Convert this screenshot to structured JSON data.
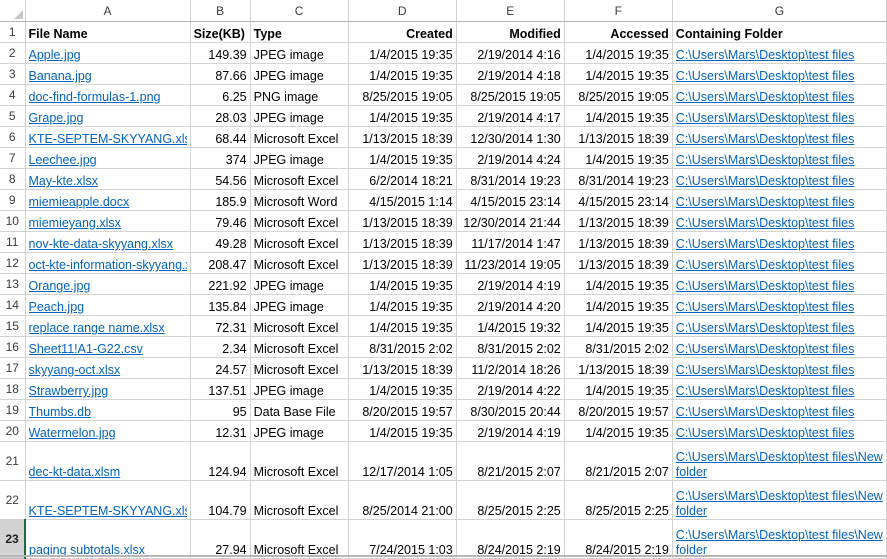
{
  "app": {
    "type": "spreadsheet",
    "corner_select_all": "select-all-corner"
  },
  "colors": {
    "hyperlink": "#0563C1",
    "gridline": "#D4D4D4",
    "header_text": "#3B3B3B",
    "active_row_fill": "#D3D3D3",
    "active_row_accent": "#1E6B41"
  },
  "column_headers": [
    "A",
    "B",
    "C",
    "D",
    "E",
    "F",
    "G"
  ],
  "row_headers": [
    "1",
    "2",
    "3",
    "4",
    "5",
    "6",
    "7",
    "8",
    "9",
    "10",
    "11",
    "12",
    "13",
    "14",
    "15",
    "16",
    "17",
    "18",
    "19",
    "20",
    "21",
    "22",
    "23"
  ],
  "active_row": "23",
  "table": {
    "headers": [
      "File Name",
      "Size(KB)",
      "Type",
      "Created",
      "Modified",
      "Accessed",
      "Containing Folder"
    ],
    "rows": [
      {
        "file_name": "Apple.jpg",
        "size": "149.39",
        "type": "JPEG image",
        "created": "1/4/2015 19:35",
        "modified": "2/19/2014 4:16",
        "accessed": "1/4/2015 19:35",
        "folder": "C:\\Users\\Mars\\Desktop\\test files"
      },
      {
        "file_name": "Banana.jpg",
        "size": "87.66",
        "type": "JPEG image",
        "created": "1/4/2015 19:35",
        "modified": "2/19/2014 4:18",
        "accessed": "1/4/2015 19:35",
        "folder": "C:\\Users\\Mars\\Desktop\\test files"
      },
      {
        "file_name": "doc-find-formulas-1.png",
        "size": "6.25",
        "type": "PNG image",
        "created": "8/25/2015 19:05",
        "modified": "8/25/2015 19:05",
        "accessed": "8/25/2015 19:05",
        "folder": "C:\\Users\\Mars\\Desktop\\test files"
      },
      {
        "file_name": "Grape.jpg",
        "size": "28.03",
        "type": "JPEG image",
        "created": "1/4/2015 19:35",
        "modified": "2/19/2014 4:17",
        "accessed": "1/4/2015 19:35",
        "folder": "C:\\Users\\Mars\\Desktop\\test files"
      },
      {
        "file_name": "KTE-SEPTEM-SKYYANG.xlsx",
        "size": "68.44",
        "type": "Microsoft Excel",
        "created": "1/13/2015 18:39",
        "modified": "12/30/2014 1:30",
        "accessed": "1/13/2015 18:39",
        "folder": "C:\\Users\\Mars\\Desktop\\test files"
      },
      {
        "file_name": "Leechee.jpg",
        "size": "374",
        "type": "JPEG image",
        "created": "1/4/2015 19:35",
        "modified": "2/19/2014 4:24",
        "accessed": "1/4/2015 19:35",
        "folder": "C:\\Users\\Mars\\Desktop\\test files"
      },
      {
        "file_name": "May-kte.xlsx",
        "size": "54.56",
        "type": "Microsoft Excel",
        "created": "6/2/2014 18:21",
        "modified": "8/31/2014 19:23",
        "accessed": "8/31/2014 19:23",
        "folder": "C:\\Users\\Mars\\Desktop\\test files"
      },
      {
        "file_name": "miemieapple.docx",
        "size": "185.9",
        "type": "Microsoft Word",
        "created": "4/15/2015 1:14",
        "modified": "4/15/2015 23:14",
        "accessed": "4/15/2015 23:14",
        "folder": "C:\\Users\\Mars\\Desktop\\test files"
      },
      {
        "file_name": "miemieyang.xlsx",
        "size": "79.46",
        "type": "Microsoft Excel",
        "created": "1/13/2015 18:39",
        "modified": "12/30/2014 21:44",
        "accessed": "1/13/2015 18:39",
        "folder": "C:\\Users\\Mars\\Desktop\\test files"
      },
      {
        "file_name": "nov-kte-data-skyyang.xlsx",
        "size": "49.28",
        "type": "Microsoft Excel",
        "created": "1/13/2015 18:39",
        "modified": "11/17/2014 1:47",
        "accessed": "1/13/2015 18:39",
        "folder": "C:\\Users\\Mars\\Desktop\\test files"
      },
      {
        "file_name": "oct-kte-information-skyyang.xlsx",
        "size": "208.47",
        "type": "Microsoft Excel",
        "created": "1/13/2015 18:39",
        "modified": "11/23/2014 19:05",
        "accessed": "1/13/2015 18:39",
        "folder": "C:\\Users\\Mars\\Desktop\\test files"
      },
      {
        "file_name": "Orange.jpg",
        "size": "221.92",
        "type": "JPEG image",
        "created": "1/4/2015 19:35",
        "modified": "2/19/2014 4:19",
        "accessed": "1/4/2015 19:35",
        "folder": "C:\\Users\\Mars\\Desktop\\test files"
      },
      {
        "file_name": "Peach.jpg",
        "size": "135.84",
        "type": "JPEG image",
        "created": "1/4/2015 19:35",
        "modified": "2/19/2014 4:20",
        "accessed": "1/4/2015 19:35",
        "folder": "C:\\Users\\Mars\\Desktop\\test files"
      },
      {
        "file_name": "replace range name.xlsx",
        "size": "72.31",
        "type": "Microsoft Excel",
        "created": "1/4/2015 19:35",
        "modified": "1/4/2015 19:32",
        "accessed": "1/4/2015 19:35",
        "folder": "C:\\Users\\Mars\\Desktop\\test files"
      },
      {
        "file_name": "Sheet11!A1-G22.csv",
        "size": "2.34",
        "type": "Microsoft Excel",
        "created": "8/31/2015 2:02",
        "modified": "8/31/2015 2:02",
        "accessed": "8/31/2015 2:02",
        "folder": "C:\\Users\\Mars\\Desktop\\test files"
      },
      {
        "file_name": "skyyang-oct.xlsx",
        "size": "24.57",
        "type": "Microsoft Excel",
        "created": "1/13/2015 18:39",
        "modified": "11/2/2014 18:26",
        "accessed": "1/13/2015 18:39",
        "folder": "C:\\Users\\Mars\\Desktop\\test files"
      },
      {
        "file_name": "Strawberry.jpg",
        "size": "137.51",
        "type": "JPEG image",
        "created": "1/4/2015 19:35",
        "modified": "2/19/2014 4:22",
        "accessed": "1/4/2015 19:35",
        "folder": "C:\\Users\\Mars\\Desktop\\test files"
      },
      {
        "file_name": "Thumbs.db",
        "size": "95",
        "type": "Data Base File",
        "created": "8/20/2015 19:57",
        "modified": "8/30/2015 20:44",
        "accessed": "8/20/2015 19:57",
        "folder": "C:\\Users\\Mars\\Desktop\\test files"
      },
      {
        "file_name": "Watermelon.jpg",
        "size": "12.31",
        "type": "JPEG image",
        "created": "1/4/2015 19:35",
        "modified": "2/19/2014 4:19",
        "accessed": "1/4/2015 19:35",
        "folder": "C:\\Users\\Mars\\Desktop\\test files"
      },
      {
        "file_name": "dec-kt-data.xlsm",
        "size": "124.94",
        "type": "Microsoft Excel",
        "created": "12/17/2014 1:05",
        "modified": "8/21/2015 2:07",
        "accessed": "8/21/2015 2:07",
        "folder": "C:\\Users\\Mars\\Desktop\\test files\\New folder"
      },
      {
        "file_name": "KTE-SEPTEM-SKYYANG.xlsx",
        "size": "104.79",
        "type": "Microsoft Excel",
        "created": "8/25/2014 21:00",
        "modified": "8/25/2015 2:25",
        "accessed": "8/25/2015 2:25",
        "folder": "C:\\Users\\Mars\\Desktop\\test files\\New folder"
      },
      {
        "file_name": "paging subtotals.xlsx",
        "size": "27.94",
        "type": "Microsoft Excel",
        "created": "7/24/2015 1:03",
        "modified": "8/24/2015 2:19",
        "accessed": "8/24/2015 2:19",
        "folder": "C:\\Users\\Mars\\Desktop\\test files\\New folder"
      }
    ]
  }
}
